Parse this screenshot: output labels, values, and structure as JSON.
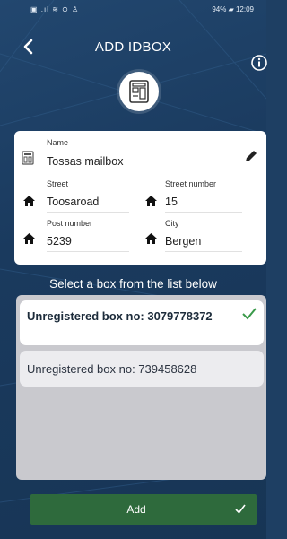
{
  "status_bar": {
    "left": "▣ .ıl ≋ ⊙ ♙",
    "right": "94% ▰ 12:09"
  },
  "header": {
    "title": "ADD IDBOX",
    "back_icon": "chevron-left-icon",
    "info_icon": "info-icon",
    "logo_icon": "mailbox-logo"
  },
  "address": {
    "name_label": "Name",
    "name_value": "Tossas mailbox",
    "street_label": "Street",
    "street_value": "Toosaroad",
    "street_number_label": "Street number",
    "street_number_value": "15",
    "post_number_label": "Post number",
    "post_number_value": "5239",
    "city_label": "City",
    "city_value": "Bergen"
  },
  "select_title": "Select a box from the list below",
  "boxes": [
    {
      "label": "Unregistered box no: 3079778372",
      "selected": true
    },
    {
      "label": "Unregistered box no: 739458628",
      "selected": false
    }
  ],
  "add_button": {
    "label": "Add"
  },
  "colors": {
    "background": "#1e3f63",
    "accent_green": "#2e6a3c",
    "check_green": "#3a9a4a"
  }
}
